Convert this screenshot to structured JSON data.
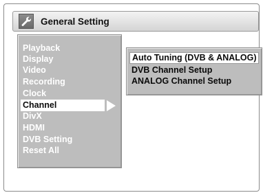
{
  "header": {
    "title": "General Setting",
    "icon": "wrench-icon"
  },
  "menu": {
    "items": [
      {
        "label": "Playback"
      },
      {
        "label": "Display"
      },
      {
        "label": "Video"
      },
      {
        "label": "Recording"
      },
      {
        "label": "Clock"
      },
      {
        "label": "Channel",
        "selected": true
      },
      {
        "label": "DivX"
      },
      {
        "label": "HDMI"
      },
      {
        "label": "DVB Setting"
      },
      {
        "label": "Reset All"
      }
    ]
  },
  "submenu": {
    "items": [
      {
        "label": "Auto Tuning (DVB & ANALOG)",
        "selected": true
      },
      {
        "label": "DVB Channel Setup"
      },
      {
        "label": "ANALOG Channel Setup"
      }
    ]
  },
  "colors": {
    "panel": "#bdbdbd",
    "highlight": "#ffffff",
    "menu_text": "#ffffff",
    "submenu_text": "#0a0a0a"
  }
}
